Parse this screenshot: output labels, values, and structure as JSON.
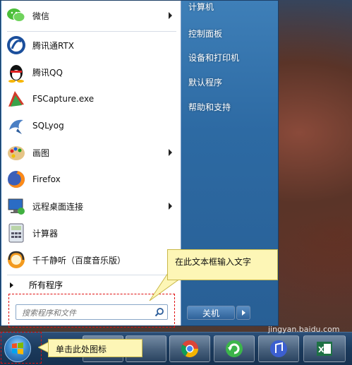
{
  "pinned_programs": [
    {
      "label": "微信",
      "icon": "wechat-icon",
      "has_submenu": true
    },
    {
      "label": "腾讯通RTX",
      "icon": "rtx-icon",
      "has_submenu": false
    },
    {
      "label": "腾讯QQ",
      "icon": "qq-penguin-icon",
      "has_submenu": false
    },
    {
      "label": "FSCapture.exe",
      "icon": "fscapture-icon",
      "has_submenu": false
    },
    {
      "label": "SQLyog",
      "icon": "dolphin-icon",
      "has_submenu": false
    },
    {
      "label": "画图",
      "icon": "paint-palette-icon",
      "has_submenu": true
    },
    {
      "label": "Firefox",
      "icon": "firefox-icon",
      "has_submenu": false
    },
    {
      "label": "远程桌面连接",
      "icon": "remote-desktop-icon",
      "has_submenu": true
    },
    {
      "label": "计算器",
      "icon": "calculator-icon",
      "has_submenu": false
    },
    {
      "label": "千千静听（百度音乐版）",
      "icon": "ttplayer-icon",
      "has_submenu": false
    }
  ],
  "all_programs_label": "所有程序",
  "search": {
    "placeholder": "搜索程序和文件"
  },
  "right_items": {
    "computer": "计算机",
    "control_panel": "控制面板",
    "devices_printers": "设备和打印机",
    "default_programs": "默认程序",
    "help_support": "帮助和支持"
  },
  "shutdown_label": "关机",
  "callouts": {
    "search_hint": "在此文本框输入文字",
    "start_hint": "单击此处图标"
  },
  "watermark": "jingyan.baidu.com",
  "colors": {
    "accent": "#2d6aa3",
    "callout_bg": "#fdf6b6",
    "highlight_box": "#e01010"
  }
}
